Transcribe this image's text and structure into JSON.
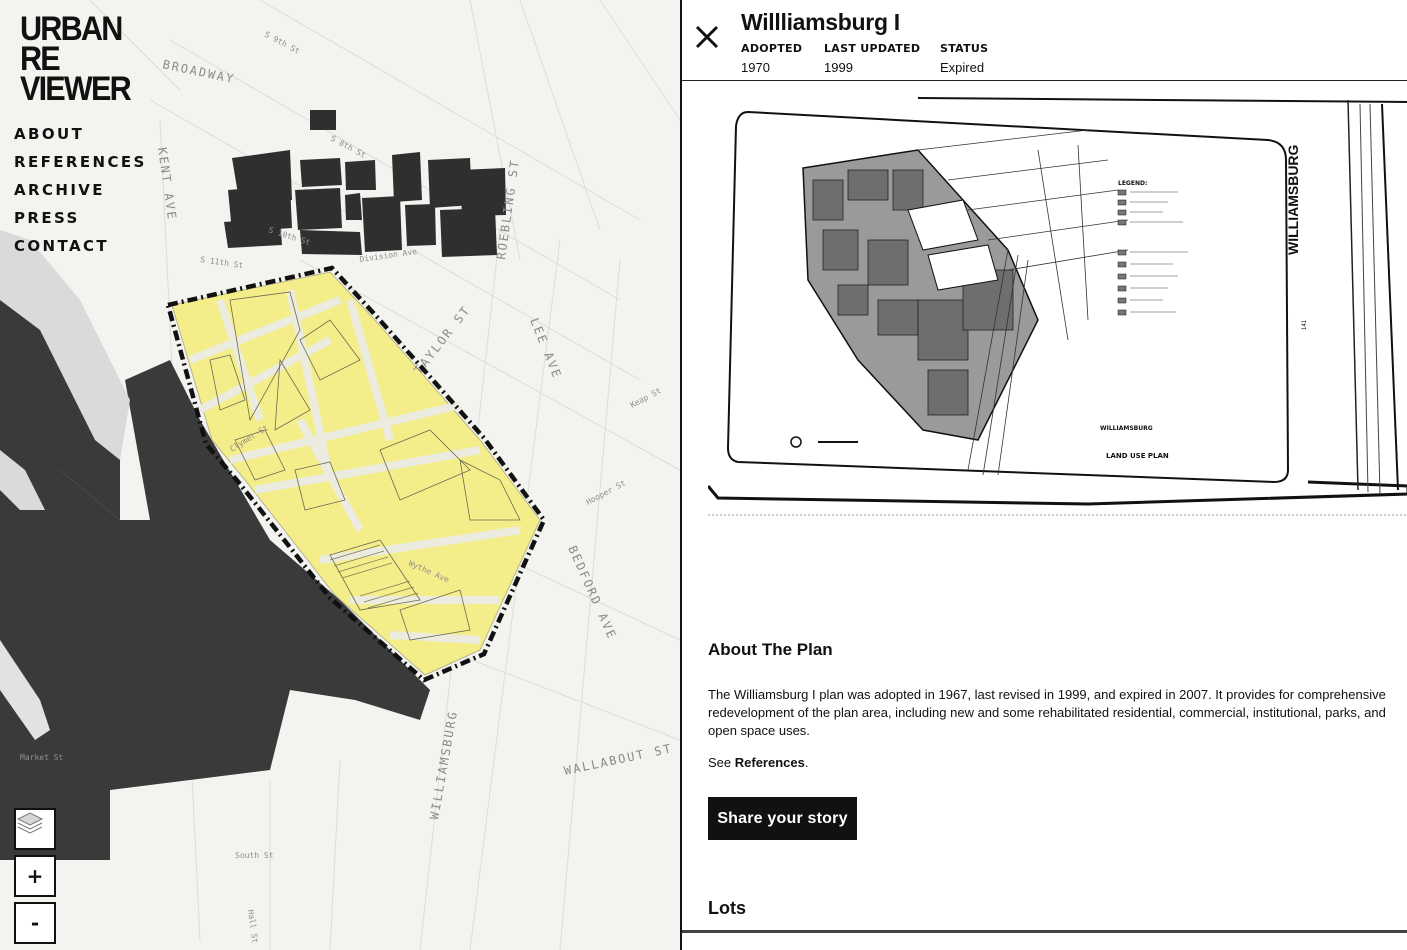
{
  "logo": {
    "line1": "URBAN",
    "line2": "RE",
    "line3": "VIEWER"
  },
  "nav": {
    "items": [
      {
        "label": "ABOUT"
      },
      {
        "label": "REFERENCES"
      },
      {
        "label": "ARCHIVE"
      },
      {
        "label": "PRESS"
      },
      {
        "label": "CONTACT"
      }
    ]
  },
  "map": {
    "controls": {
      "layers_icon": "layers-icon",
      "zoom_in": "+",
      "zoom_out": "-"
    },
    "streets": {
      "broadway": "BROADWAY",
      "kent_ave": "KENT AVE",
      "roebling_st": "ROEBLING ST",
      "taylor_st": "TAYLOR ST",
      "lee_ave": "LEE AVE",
      "bedford_ave": "BEDFORD AVE",
      "williamsburg": "WILLIAMSBURG",
      "wallabout_st": "WALLABOUT ST",
      "division_ave": "Division Ave",
      "s8th": "S 8th St",
      "s9th": "S 9th St",
      "s10th": "S 10th St",
      "s11th": "S 11th St",
      "wythe_ave": "Wythe Ave",
      "clymer_st": "Clymer St",
      "hooper_st": "Hooper St",
      "keap_st": "Keap St",
      "south_st": "South St",
      "hall_st": "Hall St",
      "market_st": "Market St"
    },
    "colors": {
      "water": "#3a3a3a",
      "plan_area": "#f4ee8a",
      "land": "#f3f3f0"
    }
  },
  "panel": {
    "close_icon": "close-icon",
    "title": "Willliamsburg I",
    "meta": [
      {
        "label": "ADOPTED",
        "value": "1970"
      },
      {
        "label": "LAST UPDATED",
        "value": "1999"
      },
      {
        "label": "STATUS",
        "value": "Expired"
      }
    ],
    "plan_image": {
      "side_title": "WILLIAMSBURG",
      "legend_title": "LEGEND:",
      "caption_title": "WILLIAMSBURG",
      "caption_sub": "LAND USE PLAN",
      "page_number": "141"
    },
    "about_heading": "About The Plan",
    "about_text": "The Williamsburg I plan was adopted in 1967, last revised in 1999, and expired in 2007. It provides for comprehensive redevelopment of the plan area, including new and some rehabilitated residential, commercial, institutional, parks, and open space uses.",
    "see_prefix": "See ",
    "see_link": "References",
    "see_suffix": ".",
    "share_button": "Share your story",
    "lots_heading": "Lots"
  }
}
